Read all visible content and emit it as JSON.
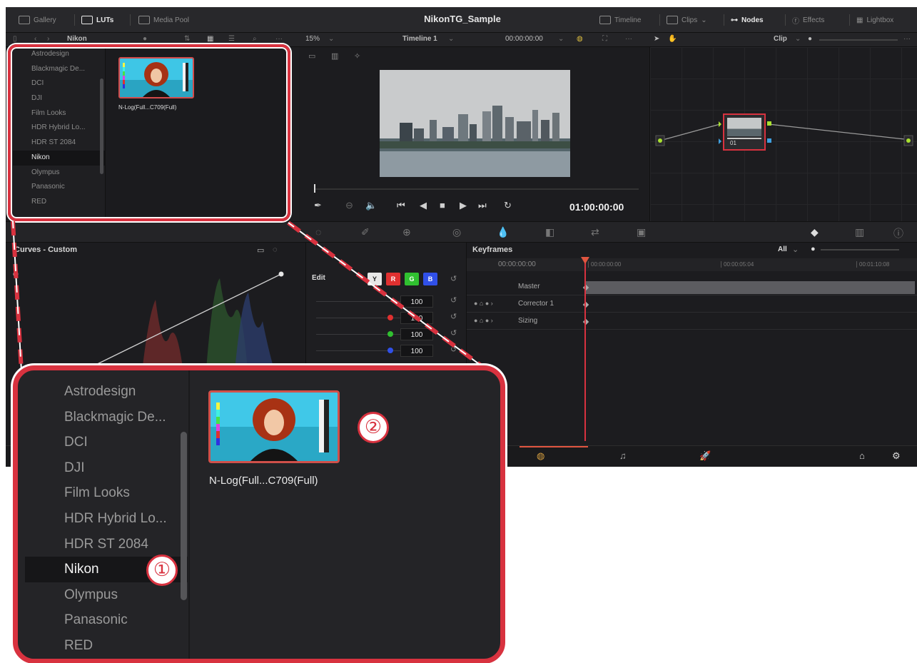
{
  "topbar": {
    "title": "NikonTG_Sample",
    "gallery": "Gallery",
    "luts": "LUTs",
    "media_pool": "Media Pool",
    "timeline": "Timeline",
    "clips": "Clips",
    "nodes": "Nodes",
    "effects": "Effects",
    "lightbox": "Lightbox"
  },
  "subbar": {
    "folder": "Nikon",
    "zoom": "15%",
    "timeline": "Timeline 1",
    "timecode": "00:00:00:00",
    "clip": "Clip"
  },
  "lut_browser": {
    "items": [
      "Astrodesign",
      "Blackmagic De...",
      "DCI",
      "DJI",
      "Film Looks",
      "HDR Hybrid Lo...",
      "HDR ST 2084",
      "Nikon",
      "Olympus",
      "Panasonic",
      "RED"
    ],
    "selected": "Nikon",
    "lut_name": "N-Log(Full...C709(Full)"
  },
  "viewer": {
    "timecode": "01:00:00:00"
  },
  "node": {
    "label": "01"
  },
  "curves": {
    "title": "Curves - Custom"
  },
  "edit": {
    "label": "Edit",
    "channels": [
      "Y",
      "R",
      "G",
      "B"
    ],
    "values": [
      "100",
      "100",
      "100",
      "100"
    ]
  },
  "keyframes": {
    "title": "Keyframes",
    "filter": "All",
    "timecode": "00:00:00:00",
    "ruler": [
      "00:00:00:00",
      "00:00:05:04",
      "00:01:10:08"
    ],
    "tracks": [
      "Master",
      "Corrector 1",
      "Sizing"
    ]
  },
  "callouts": {
    "one": "①",
    "two": "②"
  },
  "colors": {
    "highlight": "#d8323f",
    "panel": "#1e1e21"
  }
}
